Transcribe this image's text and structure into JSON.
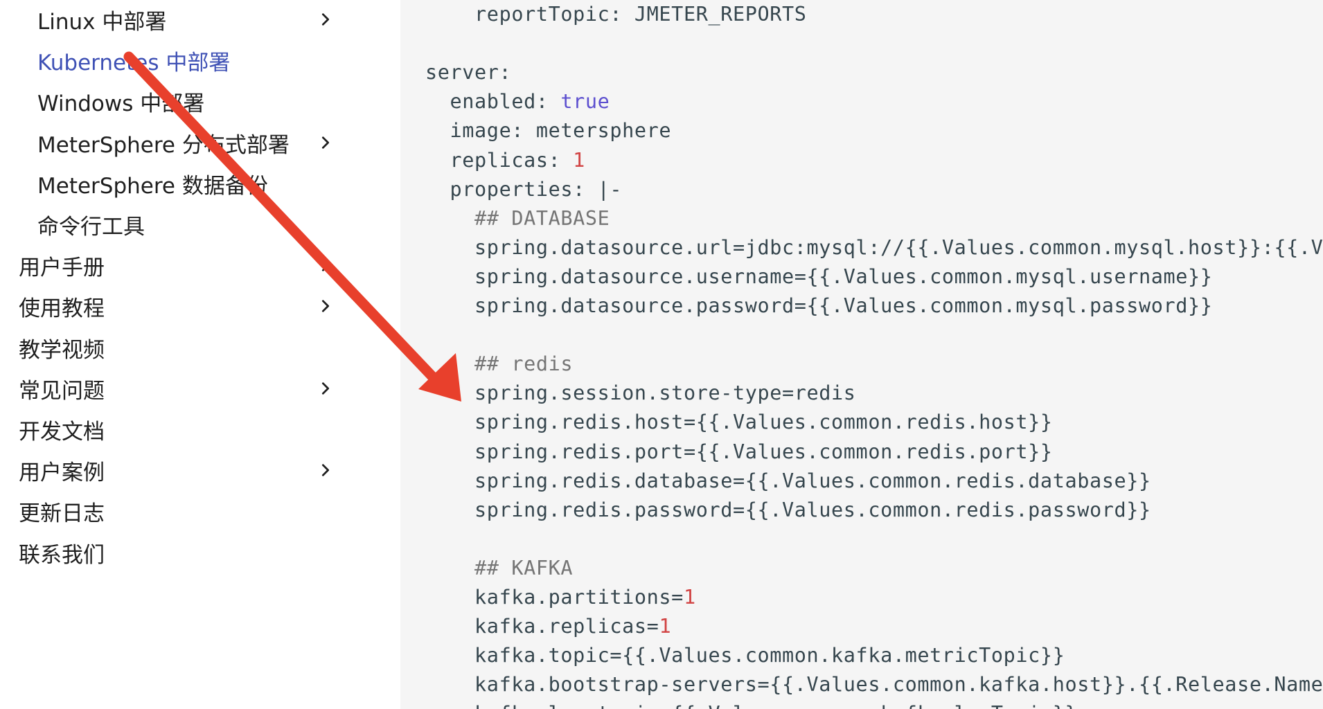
{
  "sidebar": {
    "items": [
      {
        "label": "Linux 中部署",
        "level": 2,
        "chevron": true,
        "active": false
      },
      {
        "label": "Kubernetes 中部署",
        "level": 2,
        "chevron": false,
        "active": true
      },
      {
        "label": "Windows 中部署",
        "level": 2,
        "chevron": false,
        "active": false
      },
      {
        "label": "MeterSphere 分布式部署",
        "level": 2,
        "chevron": true,
        "active": false
      },
      {
        "label": "MeterSphere 数据备份",
        "level": 2,
        "chevron": false,
        "active": false
      },
      {
        "label": "命令行工具",
        "level": 2,
        "chevron": false,
        "active": false
      },
      {
        "label": "用户手册",
        "level": 1,
        "chevron": true,
        "active": false
      },
      {
        "label": "使用教程",
        "level": 1,
        "chevron": true,
        "active": false
      },
      {
        "label": "教学视频",
        "level": 1,
        "chevron": false,
        "active": false
      },
      {
        "label": "常见问题",
        "level": 1,
        "chevron": true,
        "active": false
      },
      {
        "label": "开发文档",
        "level": 1,
        "chevron": false,
        "active": false
      },
      {
        "label": "用户案例",
        "level": 1,
        "chevron": true,
        "active": false
      },
      {
        "label": "更新日志",
        "level": 1,
        "chevron": false,
        "active": false
      },
      {
        "label": "联系我们",
        "level": 1,
        "chevron": false,
        "active": false
      }
    ]
  },
  "code": {
    "lines": [
      {
        "indent": "    ",
        "parts": [
          {
            "t": "reportTopic: JMETER_REPORTS"
          }
        ]
      },
      {
        "indent": "",
        "parts": []
      },
      {
        "indent": "",
        "parts": [
          {
            "t": "server:"
          }
        ]
      },
      {
        "indent": "  ",
        "parts": [
          {
            "t": "enabled: "
          },
          {
            "t": "true",
            "c": "kw"
          }
        ]
      },
      {
        "indent": "  ",
        "parts": [
          {
            "t": "image: metersphere"
          }
        ]
      },
      {
        "indent": "  ",
        "parts": [
          {
            "t": "replicas: "
          },
          {
            "t": "1",
            "c": "num"
          }
        ]
      },
      {
        "indent": "  ",
        "parts": [
          {
            "t": "properties: |-"
          }
        ]
      },
      {
        "indent": "    ",
        "parts": [
          {
            "t": "## DATABASE",
            "c": "cm"
          }
        ]
      },
      {
        "indent": "    ",
        "parts": [
          {
            "t": "spring.datasource.url=jdbc:mysql://{{.Values.common.mysql.host}}:{{.Values.common.mysql.port}}"
          }
        ]
      },
      {
        "indent": "    ",
        "parts": [
          {
            "t": "spring.datasource.username={{.Values.common.mysql.username}}"
          }
        ]
      },
      {
        "indent": "    ",
        "parts": [
          {
            "t": "spring.datasource.password={{.Values.common.mysql.password}}"
          }
        ]
      },
      {
        "indent": "",
        "parts": []
      },
      {
        "indent": "    ",
        "parts": [
          {
            "t": "## redis",
            "c": "cm"
          }
        ]
      },
      {
        "indent": "    ",
        "parts": [
          {
            "t": "spring.session.store-type=redis"
          }
        ]
      },
      {
        "indent": "    ",
        "parts": [
          {
            "t": "spring.redis.host={{.Values.common.redis.host}}"
          }
        ]
      },
      {
        "indent": "    ",
        "parts": [
          {
            "t": "spring.redis.port={{.Values.common.redis.port}}"
          }
        ]
      },
      {
        "indent": "    ",
        "parts": [
          {
            "t": "spring.redis.database={{.Values.common.redis.database}}"
          }
        ]
      },
      {
        "indent": "    ",
        "parts": [
          {
            "t": "spring.redis.password={{.Values.common.redis.password}}"
          }
        ]
      },
      {
        "indent": "",
        "parts": []
      },
      {
        "indent": "    ",
        "parts": [
          {
            "t": "## KAFKA",
            "c": "cm"
          }
        ]
      },
      {
        "indent": "    ",
        "parts": [
          {
            "t": "kafka.partitions="
          },
          {
            "t": "1",
            "c": "num"
          }
        ]
      },
      {
        "indent": "    ",
        "parts": [
          {
            "t": "kafka.replicas="
          },
          {
            "t": "1",
            "c": "num"
          }
        ]
      },
      {
        "indent": "    ",
        "parts": [
          {
            "t": "kafka.topic={{.Values.common.kafka.metricTopic}}"
          }
        ]
      },
      {
        "indent": "    ",
        "parts": [
          {
            "t": "kafka.bootstrap-servers={{.Values.common.kafka.host}}.{{.Release.Namespace}}"
          }
        ]
      },
      {
        "indent": "    ",
        "parts": [
          {
            "t": "kafka.log.topic={{.Values.common.kafka.logTopic}}"
          }
        ]
      }
    ]
  },
  "colors": {
    "accent": "#3f51b5",
    "arrow": "#e8402c",
    "code_bg": "#f5f5f5",
    "keyword": "#5c4fcf",
    "number": "#d14343"
  }
}
